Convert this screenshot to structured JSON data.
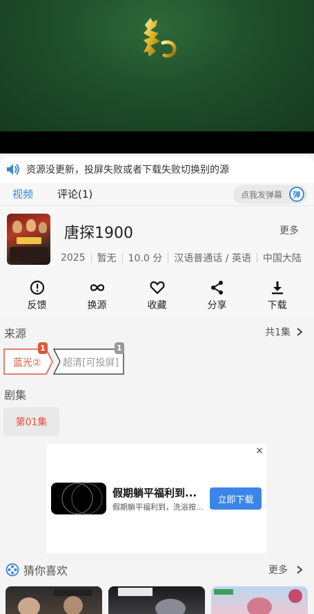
{
  "notice": {
    "text": "资源没更新，投屏失败或者下载失败切换别的源"
  },
  "tabs": {
    "video": "视频",
    "comments": "评论(1)"
  },
  "danmu": {
    "placeholder": "点我发弹幕",
    "badge": "弹"
  },
  "movie": {
    "title": "唐探1900",
    "more": "更多",
    "meta": [
      "2025",
      "暂无",
      "10.0 分",
      "汉语普通话 / 英语",
      "中国大陆"
    ]
  },
  "actions": [
    {
      "label": "反馈",
      "icon": "feedback-icon"
    },
    {
      "label": "换源",
      "icon": "switch-source-icon"
    },
    {
      "label": "收藏",
      "icon": "heart-icon"
    },
    {
      "label": "分享",
      "icon": "share-icon"
    },
    {
      "label": "下载",
      "icon": "download-icon"
    }
  ],
  "source": {
    "title": "来源",
    "count": "共1集",
    "items": [
      {
        "label": "蓝光②",
        "badge": "1",
        "active": true
      },
      {
        "label": "超清[可投屏]",
        "badge": "1",
        "active": false
      }
    ]
  },
  "episodes": {
    "title": "剧集",
    "items": [
      "第01集"
    ]
  },
  "ad": {
    "close": "×",
    "title": "假期躺平福利到...",
    "desc": "假期躺平福利到，洗浴按...",
    "button": "立即下载"
  },
  "guess": {
    "title": "猜你喜欢",
    "more": "更多"
  },
  "colors": {
    "accent": "#3a86d6",
    "active_red": "#e0543c",
    "ad_button": "#3a86e8"
  }
}
